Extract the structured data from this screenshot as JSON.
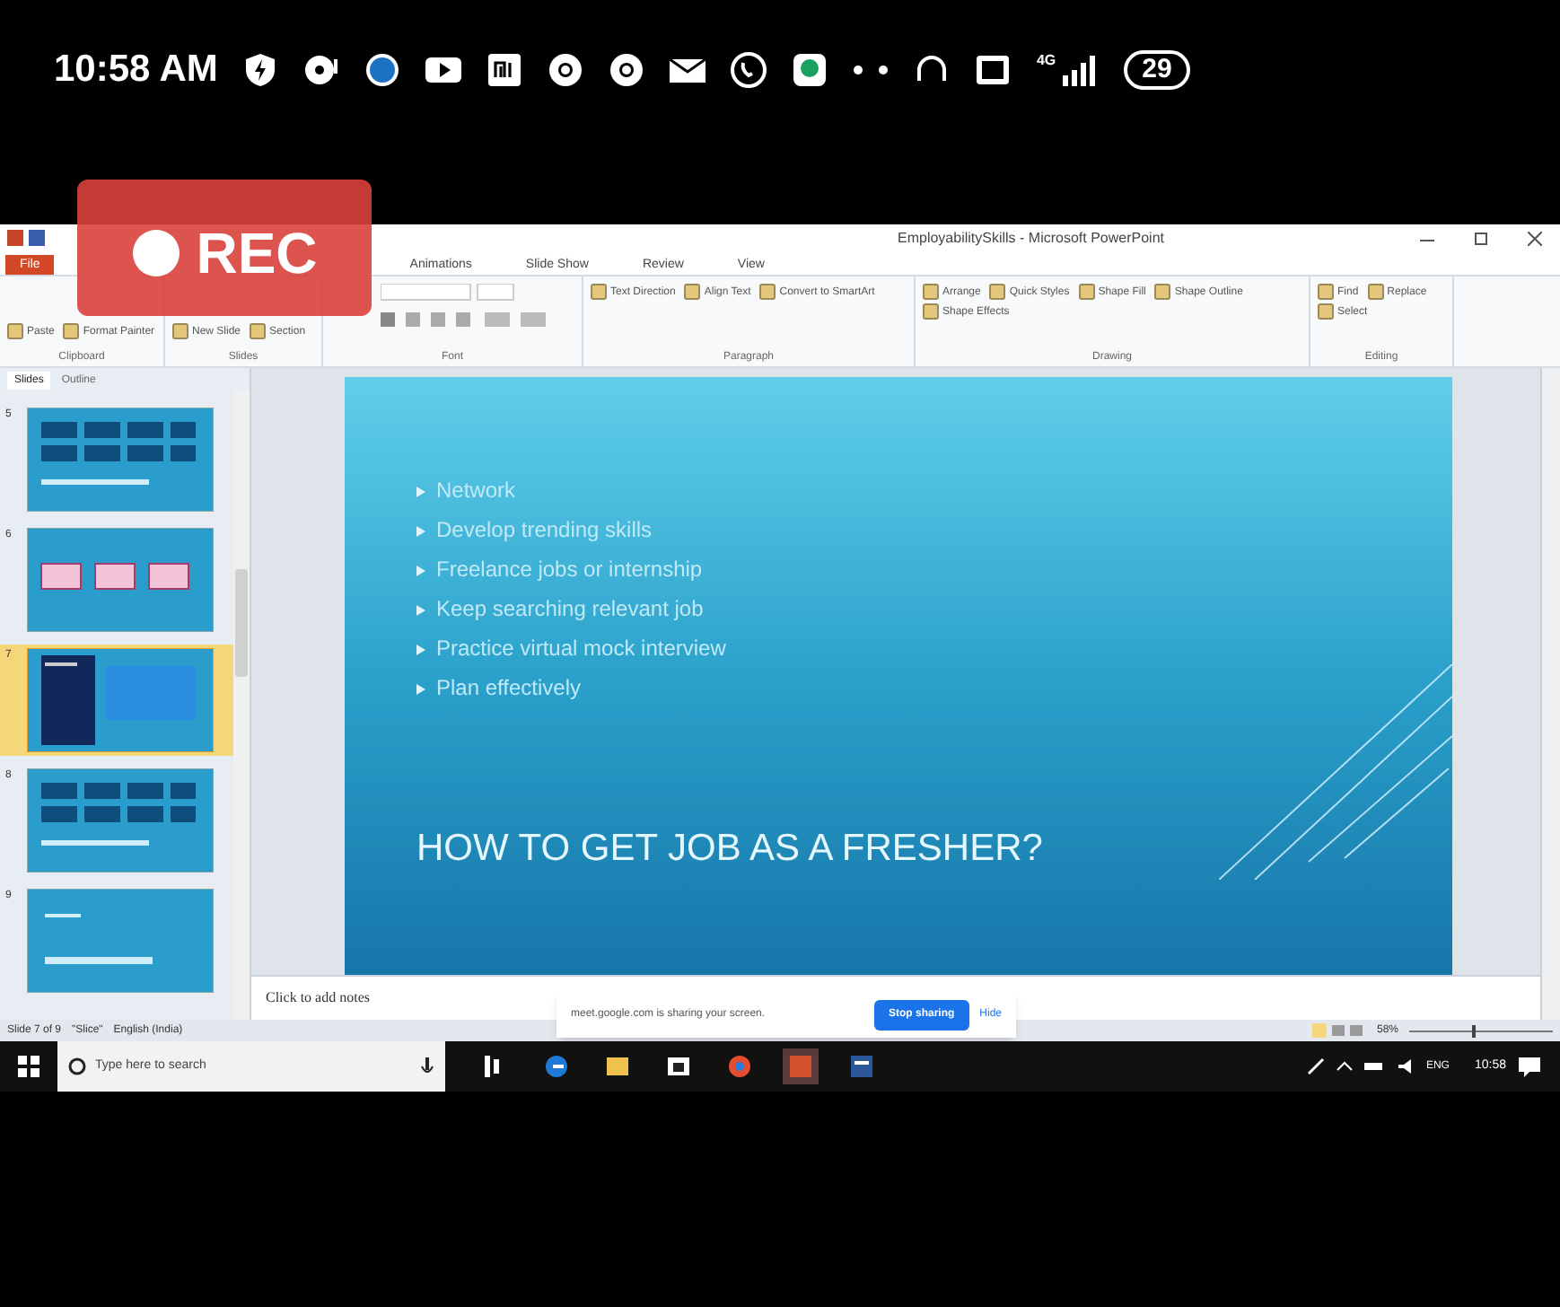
{
  "phone_status": {
    "time": "10:58 AM",
    "network": "4G",
    "battery": "29"
  },
  "recording_badge": {
    "label": "REC"
  },
  "window": {
    "title": "EmployabilitySkills - Microsoft PowerPoint"
  },
  "ribbon_tabs": [
    {
      "label": "File",
      "kind": "file",
      "selected": false
    },
    {
      "label": "Animations",
      "kind": "tab",
      "selected": false
    },
    {
      "label": "Slide Show",
      "kind": "tab",
      "selected": false
    },
    {
      "label": "Review",
      "kind": "tab",
      "selected": false
    },
    {
      "label": "View",
      "kind": "tab",
      "selected": false
    }
  ],
  "ribbon_groups": [
    {
      "label": "Clipboard",
      "buttons": [
        "Paste",
        "Format Painter"
      ]
    },
    {
      "label": "Slides",
      "buttons": [
        "New Slide",
        "Section"
      ]
    },
    {
      "label": "Font"
    },
    {
      "label": "Paragraph",
      "buttons": [
        "Text Direction",
        "Align Text",
        "Convert to SmartArt"
      ]
    },
    {
      "label": "Drawing",
      "buttons": [
        "Arrange",
        "Quick Styles",
        "Shape Fill",
        "Shape Outline",
        "Shape Effects"
      ]
    },
    {
      "label": "Editing",
      "buttons": [
        "Find",
        "Replace",
        "Select"
      ]
    }
  ],
  "slide_panel": {
    "tabs": [
      {
        "label": "Slides",
        "selected": true
      },
      {
        "label": "Outline",
        "selected": false
      }
    ],
    "thumbnails": [
      {
        "number": "5",
        "kind": "grid",
        "selected": false
      },
      {
        "number": "6",
        "kind": "boxes",
        "selected": false
      },
      {
        "number": "7",
        "kind": "dark",
        "selected": true
      },
      {
        "number": "8",
        "kind": "grid",
        "selected": false
      },
      {
        "number": "9",
        "kind": "title",
        "selected": false
      }
    ]
  },
  "slide": {
    "bullets": [
      "Network",
      "Develop trending skills",
      "Freelance jobs or internship",
      "Keep searching relevant job",
      "Practice virtual mock interview",
      "Plan effectively"
    ],
    "title": "HOW TO GET JOB AS A FRESHER?"
  },
  "notes": {
    "placeholder": "Click to add notes"
  },
  "share_banner": {
    "message": "meet.google.com is sharing your screen.",
    "stop_button": "Stop sharing",
    "hide_button": "Hide"
  },
  "status_bar": {
    "slide_info": "Slide 7 of 9",
    "theme": "\"Slice\"",
    "language": "English (India)",
    "zoom": "58%",
    "zoom_slider": {
      "level": 0.45
    }
  },
  "taskbar": {
    "search_placeholder": "Type here to search",
    "language": "ENG",
    "time": "10:58"
  }
}
